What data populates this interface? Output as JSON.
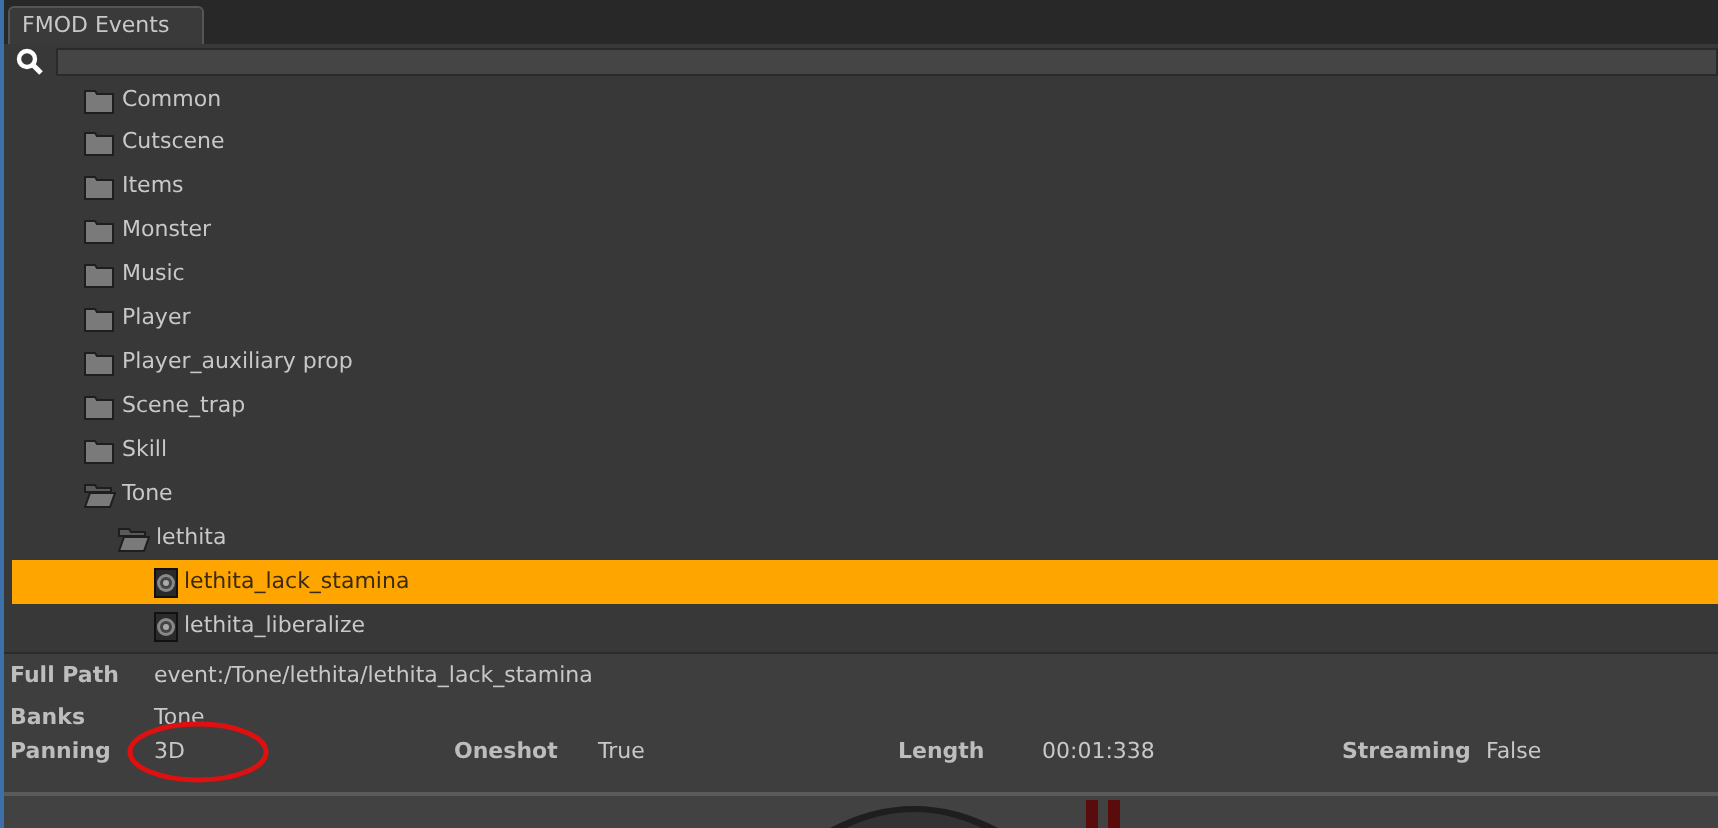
{
  "tab": {
    "label": "FMOD Events",
    "selected": true
  },
  "tree": [
    {
      "label": "Common",
      "kind": "folder",
      "expanded": false,
      "selected": false
    },
    {
      "label": "Cutscene",
      "kind": "folder",
      "expanded": false,
      "selected": false
    },
    {
      "label": "Items",
      "kind": "folder",
      "expanded": false,
      "selected": false
    },
    {
      "label": "Monster",
      "kind": "folder",
      "expanded": false,
      "selected": false
    },
    {
      "label": "Music",
      "kind": "folder",
      "expanded": false,
      "selected": false
    },
    {
      "label": "Player",
      "kind": "folder",
      "expanded": false,
      "selected": false
    },
    {
      "label": "Player_auxiliary prop",
      "kind": "folder",
      "expanded": false,
      "selected": false
    },
    {
      "label": "Scene_trap",
      "kind": "folder",
      "expanded": false,
      "selected": false
    },
    {
      "label": "Skill",
      "kind": "folder",
      "expanded": false,
      "selected": false
    },
    {
      "label": "Tone",
      "kind": "folder",
      "expanded": true,
      "selected": false,
      "children": [
        {
          "label": "lethita",
          "kind": "folder",
          "expanded": true,
          "selected": false,
          "children": [
            {
              "label": "lethita_lack_stamina",
              "kind": "event",
              "selected": true
            },
            {
              "label": "lethita_liberalize",
              "kind": "event",
              "selected": false
            }
          ]
        }
      ]
    }
  ],
  "details": {
    "full_path": {
      "label": "Full Path",
      "value": "event:/Tone/lethita/lethita_lack_stamina"
    },
    "banks": {
      "label": "Banks",
      "value": "Tone"
    },
    "properties": [
      {
        "label": "Panning",
        "value": "3D",
        "circled": true
      },
      {
        "label": "Oneshot",
        "value": "True",
        "circled": false
      },
      {
        "label": "Length",
        "value": "00:01:338",
        "circled": false
      },
      {
        "label": "Streaming",
        "value": "False",
        "circled": false
      }
    ]
  }
}
